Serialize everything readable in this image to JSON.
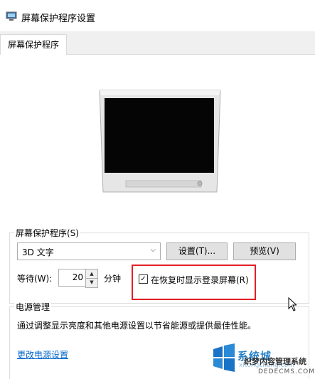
{
  "window": {
    "title": "屏幕保护程序设置"
  },
  "tabs": [
    {
      "label": "屏幕保护程序"
    }
  ],
  "screensaver": {
    "group_label": "屏幕保护程序(S)",
    "selected": "3D 文字",
    "settings_button": "设置(T)...",
    "preview_button": "预览(V)",
    "wait_label": "等待(W):",
    "wait_value": "20",
    "wait_unit": "分钟",
    "resume_checkbox_label": "在恢复时显示登录屏幕(R)",
    "resume_checked": true
  },
  "power": {
    "group_label": "电源管理",
    "description": "通过调整显示亮度和其他电源设置以节省能源或提供最佳性能。",
    "link": "更改电源设置"
  },
  "watermark": {
    "text": "系统城",
    "sub": "xitongcheng.com",
    "brand": "织梦内容管理系统",
    "url": "DEDECMS.COM"
  },
  "colors": {
    "highlight": "#e41e25",
    "link": "#0066cc"
  }
}
